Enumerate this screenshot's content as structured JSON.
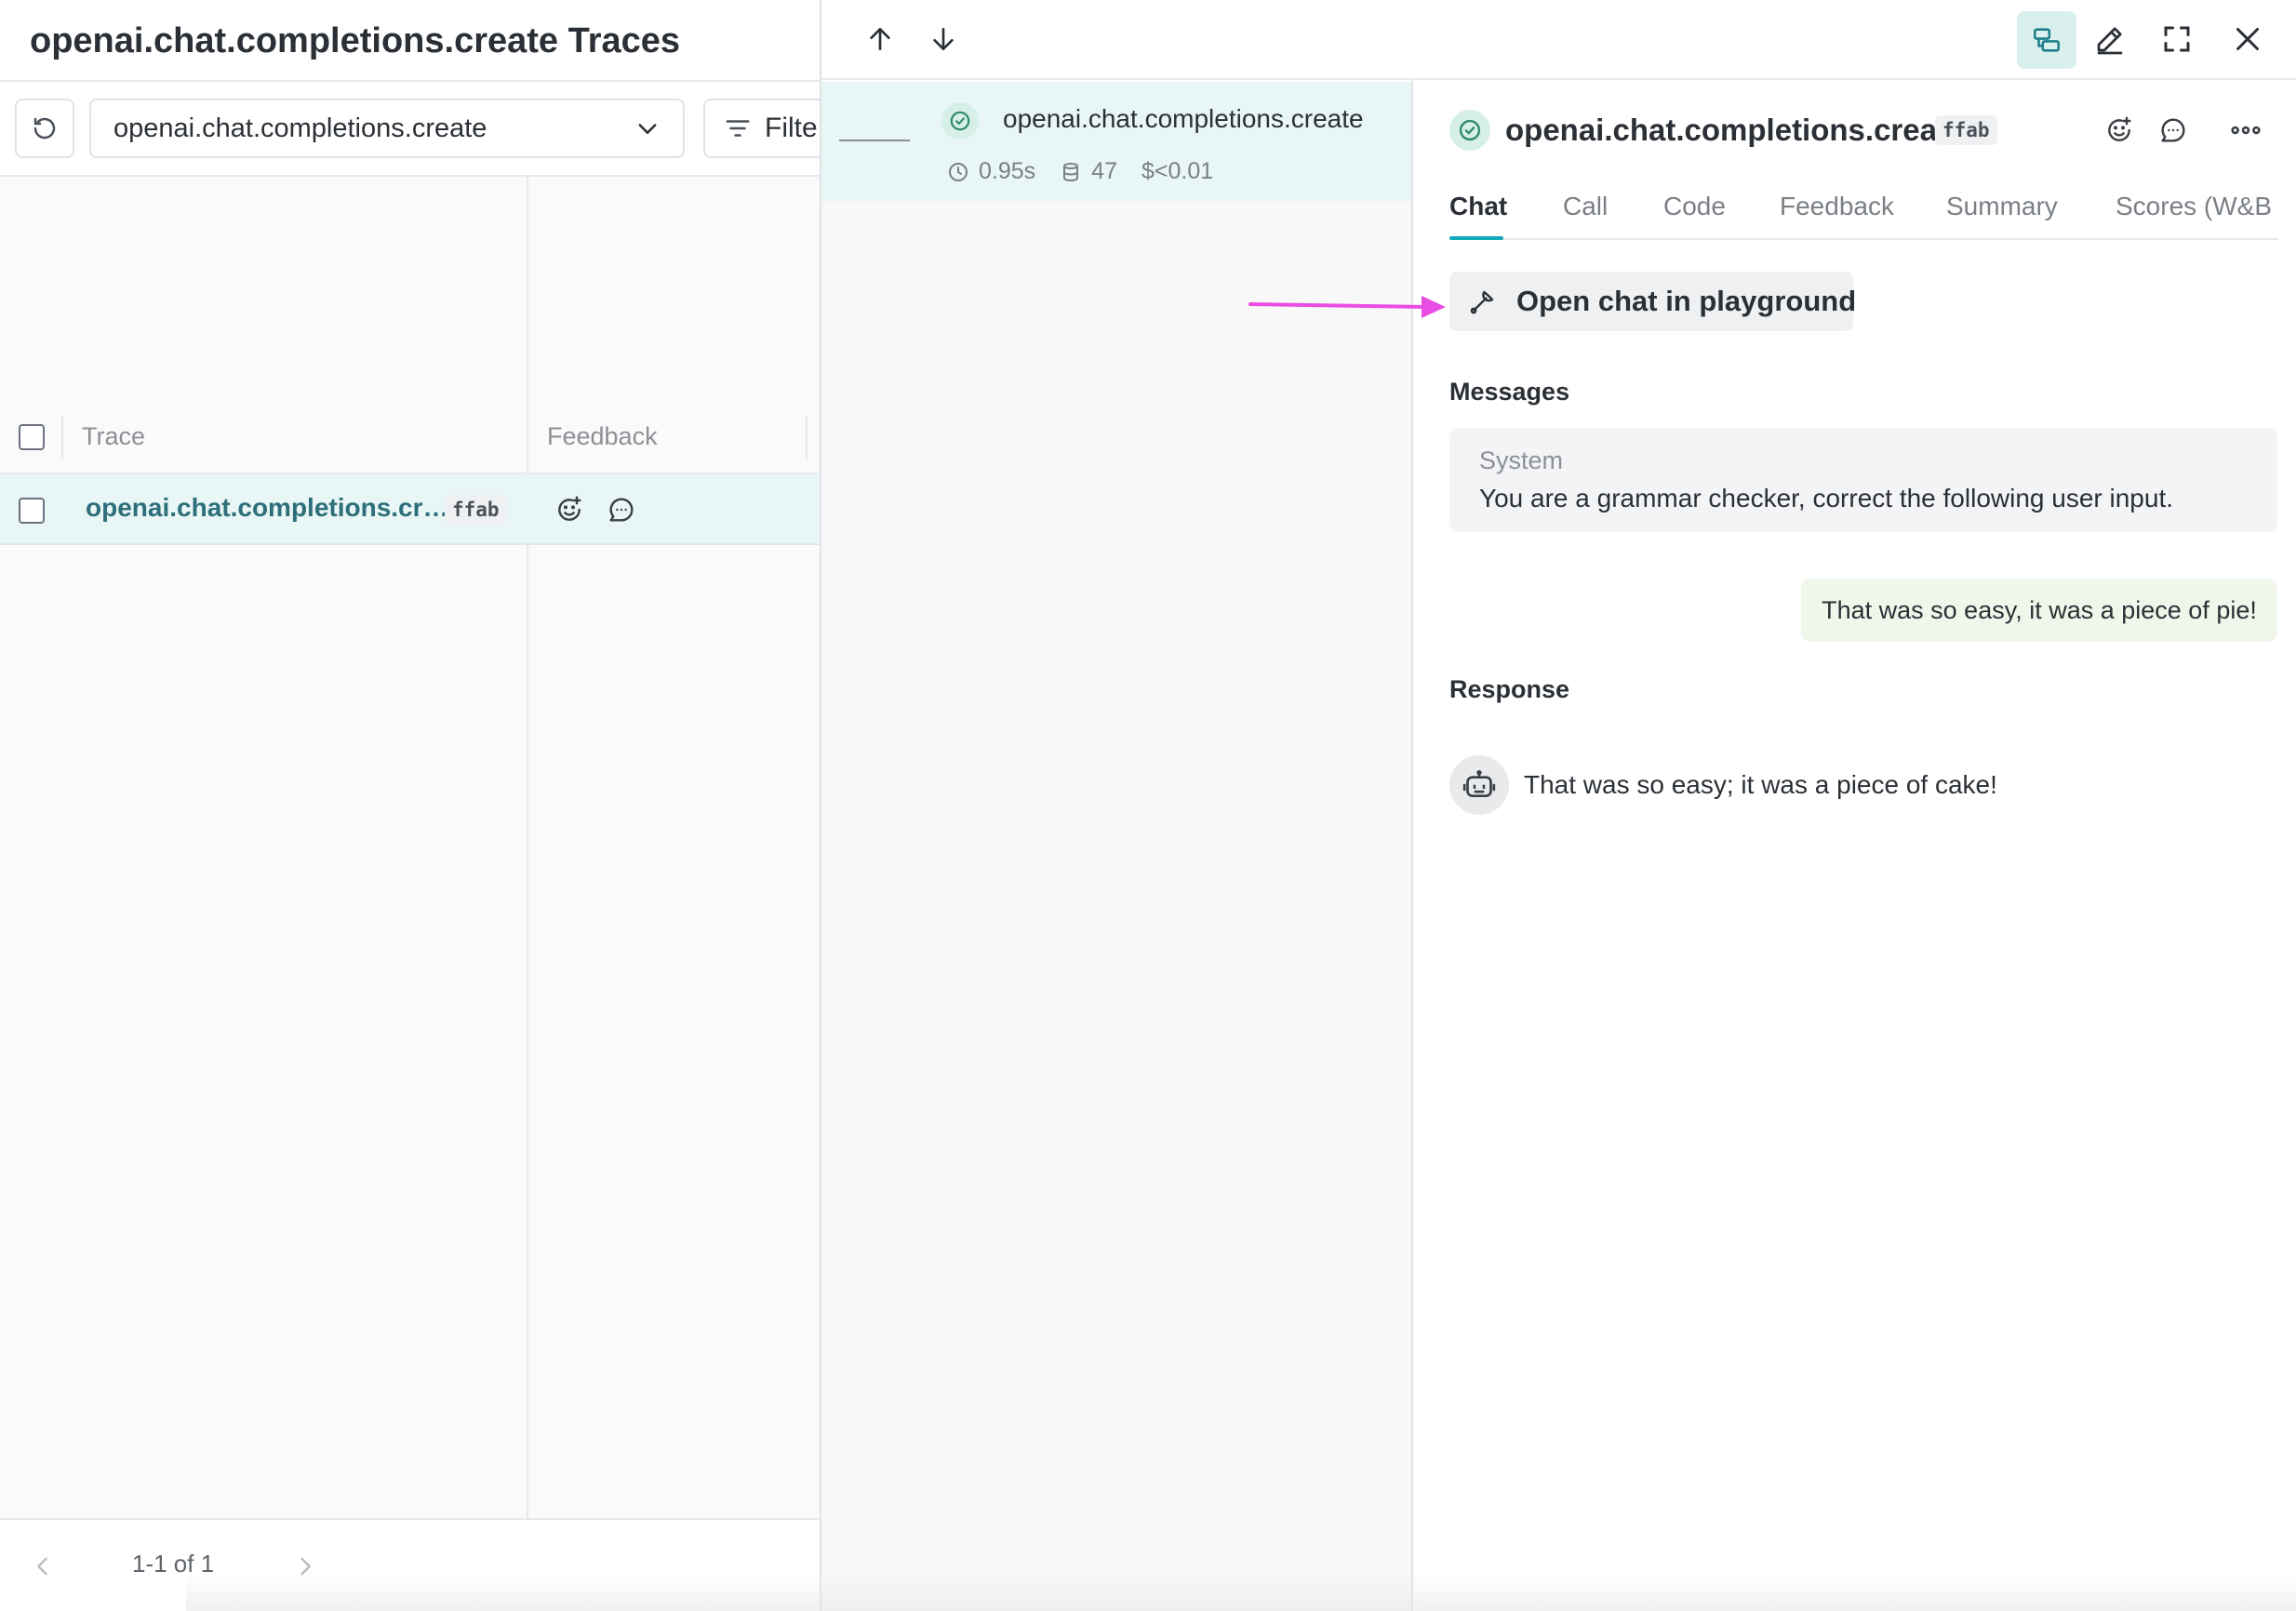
{
  "page_title": "openai.chat.completions.create Traces",
  "toolbar": {
    "operation_select": "openai.chat.completions.create",
    "filter_label": "Filte"
  },
  "table": {
    "columns": [
      "Trace",
      "Feedback"
    ],
    "rows": [
      {
        "trace": "openai.chat.completions.cr…",
        "digest": "ffab"
      }
    ]
  },
  "pager": {
    "text": "1-1 of 1"
  },
  "trace_tree": {
    "node_name": "openai.chat.completions.create",
    "latency": "0.95s",
    "tokens": "47",
    "cost": "$<0.01"
  },
  "detail": {
    "call_name": "openai.chat.completions.create",
    "digest": "ffab",
    "tabs": [
      "Chat",
      "Call",
      "Code",
      "Feedback",
      "Summary",
      "Scores (W&B A"
    ],
    "active_tab": "Chat",
    "playground_button": "Open chat in playground",
    "messages_label": "Messages",
    "system_role": "System",
    "system_text": "You are a grammar checker, correct the following user input.",
    "user_text": "That was so easy, it was a piece of pie!",
    "response_label": "Response",
    "response_text": "That was so easy; it was a piece of cake!"
  },
  "colors": {
    "accent_teal": "#13a9ba",
    "selected_row": "#e8f6f5",
    "annotation_arrow": "#e94de3",
    "trace_link": "#2e6f7b"
  },
  "icons": {
    "refresh": "refresh-icon",
    "chevron": "chevron-down-icon",
    "filter": "filter-icon",
    "status": "check-circle-icon",
    "clock": "clock-icon",
    "tokens": "database-icon",
    "split_view": "split-view-icon",
    "edit": "pencil-icon",
    "fullscreen": "fullscreen-icon",
    "close": "close-icon",
    "react": "emoji-add-icon",
    "comment": "comment-icon",
    "more": "more-horizontal-icon",
    "playground": "wrench-icon",
    "bot": "robot-icon"
  }
}
